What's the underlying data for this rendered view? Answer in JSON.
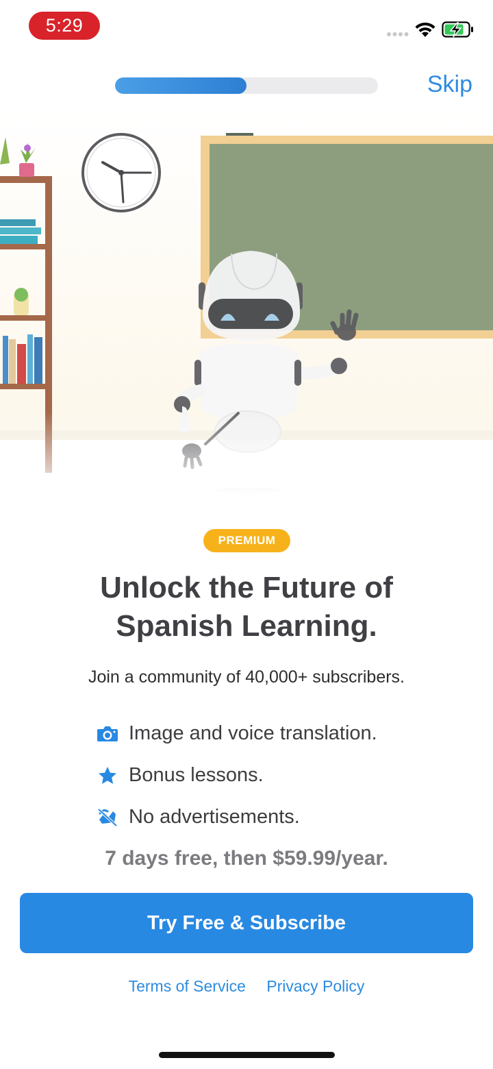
{
  "status_bar": {
    "time": "5:29",
    "time_pill_color": "#d8232a",
    "icons": [
      "signal-dots-icon",
      "wifi-icon",
      "battery-charging-icon"
    ]
  },
  "onboarding": {
    "progress": 0.5,
    "skip_label": "Skip"
  },
  "paywall": {
    "badge": "PREMIUM",
    "headline_line1": "Unlock the Future of",
    "headline_line2": "Spanish Learning.",
    "subtitle": "Join a community of 40,000+ subscribers.",
    "features": [
      {
        "icon": "camera-icon",
        "text": "Image and voice translation."
      },
      {
        "icon": "star-icon",
        "text": "Bonus lessons."
      },
      {
        "icon": "no-ads-icon",
        "text": "No advertisements."
      }
    ],
    "price": "7 days free, then $59.99/year.",
    "cta_label": "Try Free & Subscribe",
    "terms_label": "Terms of Service",
    "privacy_label": "Privacy Policy"
  },
  "colors": {
    "accent": "#2889e2",
    "badge": "#f7b21b",
    "link": "#2d8be0"
  }
}
